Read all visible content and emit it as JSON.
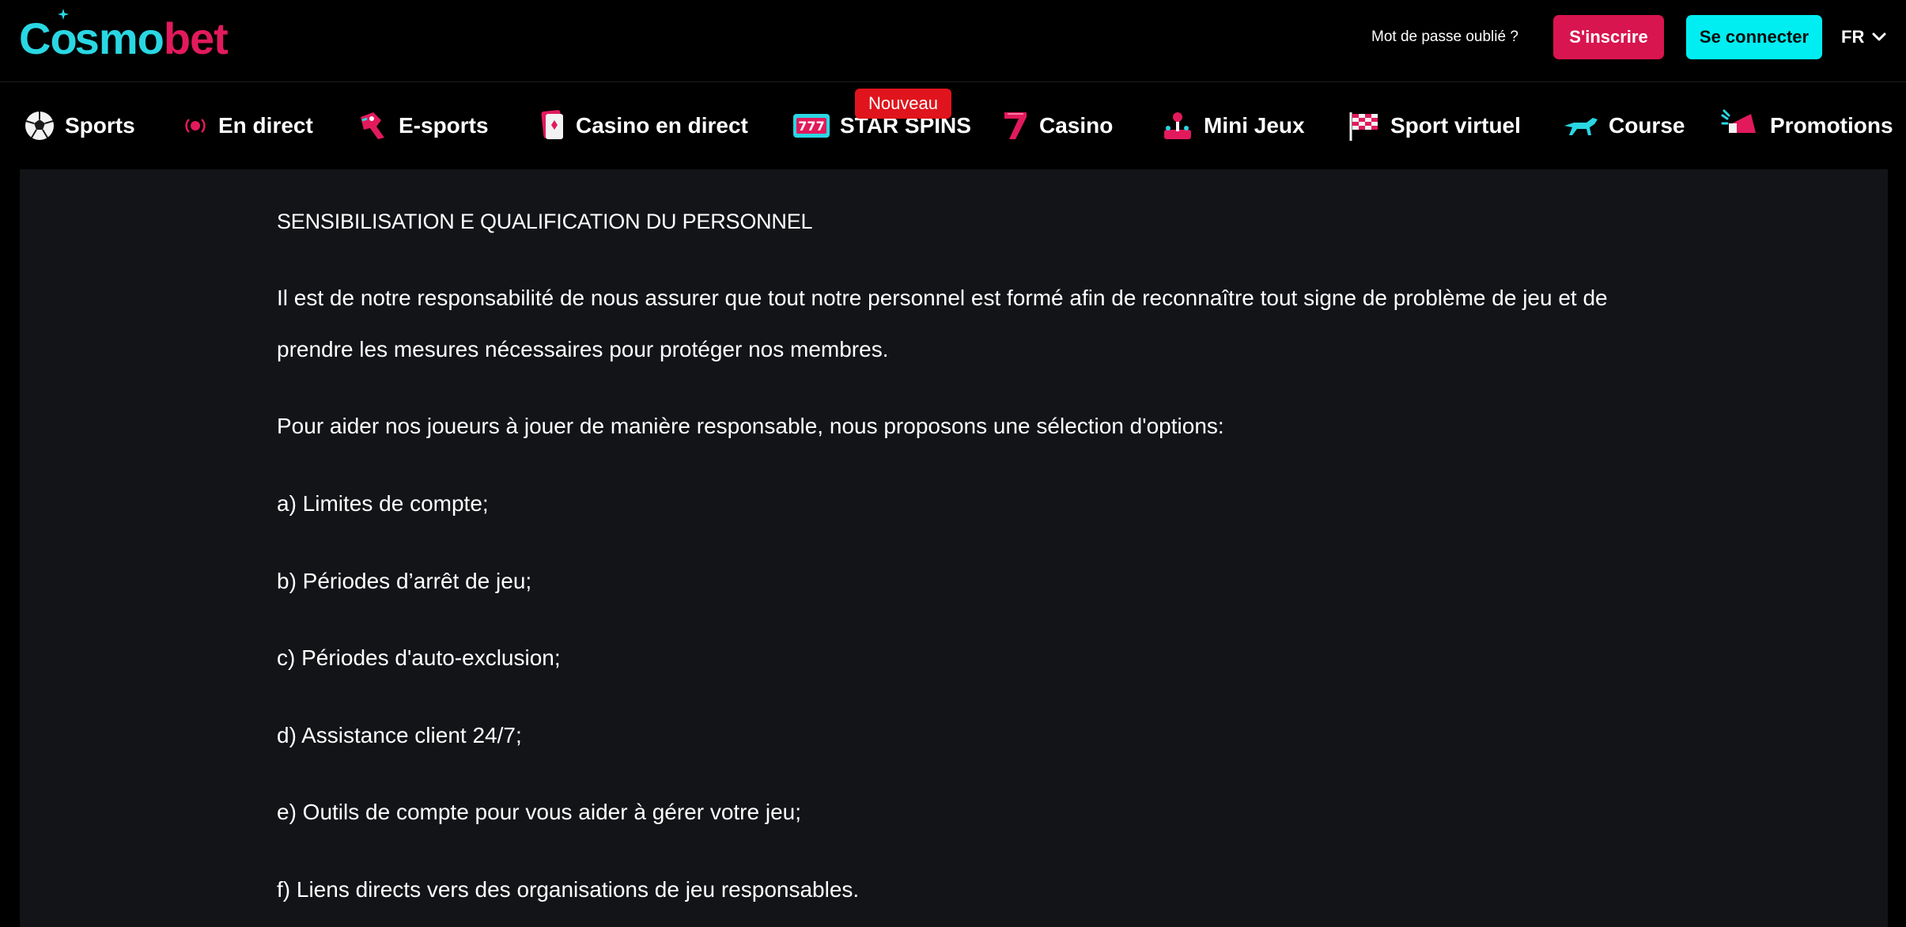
{
  "header": {
    "logo": {
      "part1": "C",
      "part2": "smo",
      "part3": "bet",
      "o_char": "o"
    },
    "forgot_password": "Mot de passe oublié ?",
    "signup_label": "S'inscrire",
    "login_label": "Se connecter",
    "language": "FR"
  },
  "nav": {
    "items": [
      {
        "label": "Sports",
        "icon": "soccer-ball-icon"
      },
      {
        "label": "En direct",
        "icon": "live-broadcast-icon"
      },
      {
        "label": "E-sports",
        "icon": "gamepad-icon"
      },
      {
        "label": "Casino en direct",
        "icon": "playing-card-icon"
      },
      {
        "label": "STAR SPINS",
        "icon": "slot-777-icon"
      },
      {
        "label": "Casino",
        "icon": "lucky-seven-icon"
      },
      {
        "label": "Mini Jeux",
        "icon": "joystick-icon"
      },
      {
        "label": "Sport virtuel",
        "icon": "checkered-flag-icon"
      },
      {
        "label": "Course",
        "icon": "greyhound-icon"
      },
      {
        "label": "Promotions",
        "icon": "megaphone-icon"
      }
    ],
    "new_badge": "Nouveau"
  },
  "content": {
    "heading": "SENSIBILISATION E QUALIFICATION DU PERSONNEL",
    "intro": "Il est de notre responsabilité de nous assurer que tout notre personnel est formé afin de reconnaître tout signe de problème de jeu et de prendre les mesures nécessaires pour protéger nos membres.",
    "options_intro": "Pour aider nos joueurs à jouer de manière responsable, nous proposons une sélection d'options:",
    "options": [
      "a) Limites de compte;",
      "b) Périodes d’arrêt de jeu;",
      "c) Périodes d'auto-exclusion;",
      "d) Assistance client 24/7;",
      "e) Outils de compte pour vous aider à gérer votre jeu;",
      "f) Liens directs vers des organisations de jeu responsables."
    ]
  },
  "colors": {
    "brand_cyan": "#00eef2",
    "brand_pink": "#d8154e",
    "badge_red": "#e0141c",
    "content_bg": "#131417"
  }
}
